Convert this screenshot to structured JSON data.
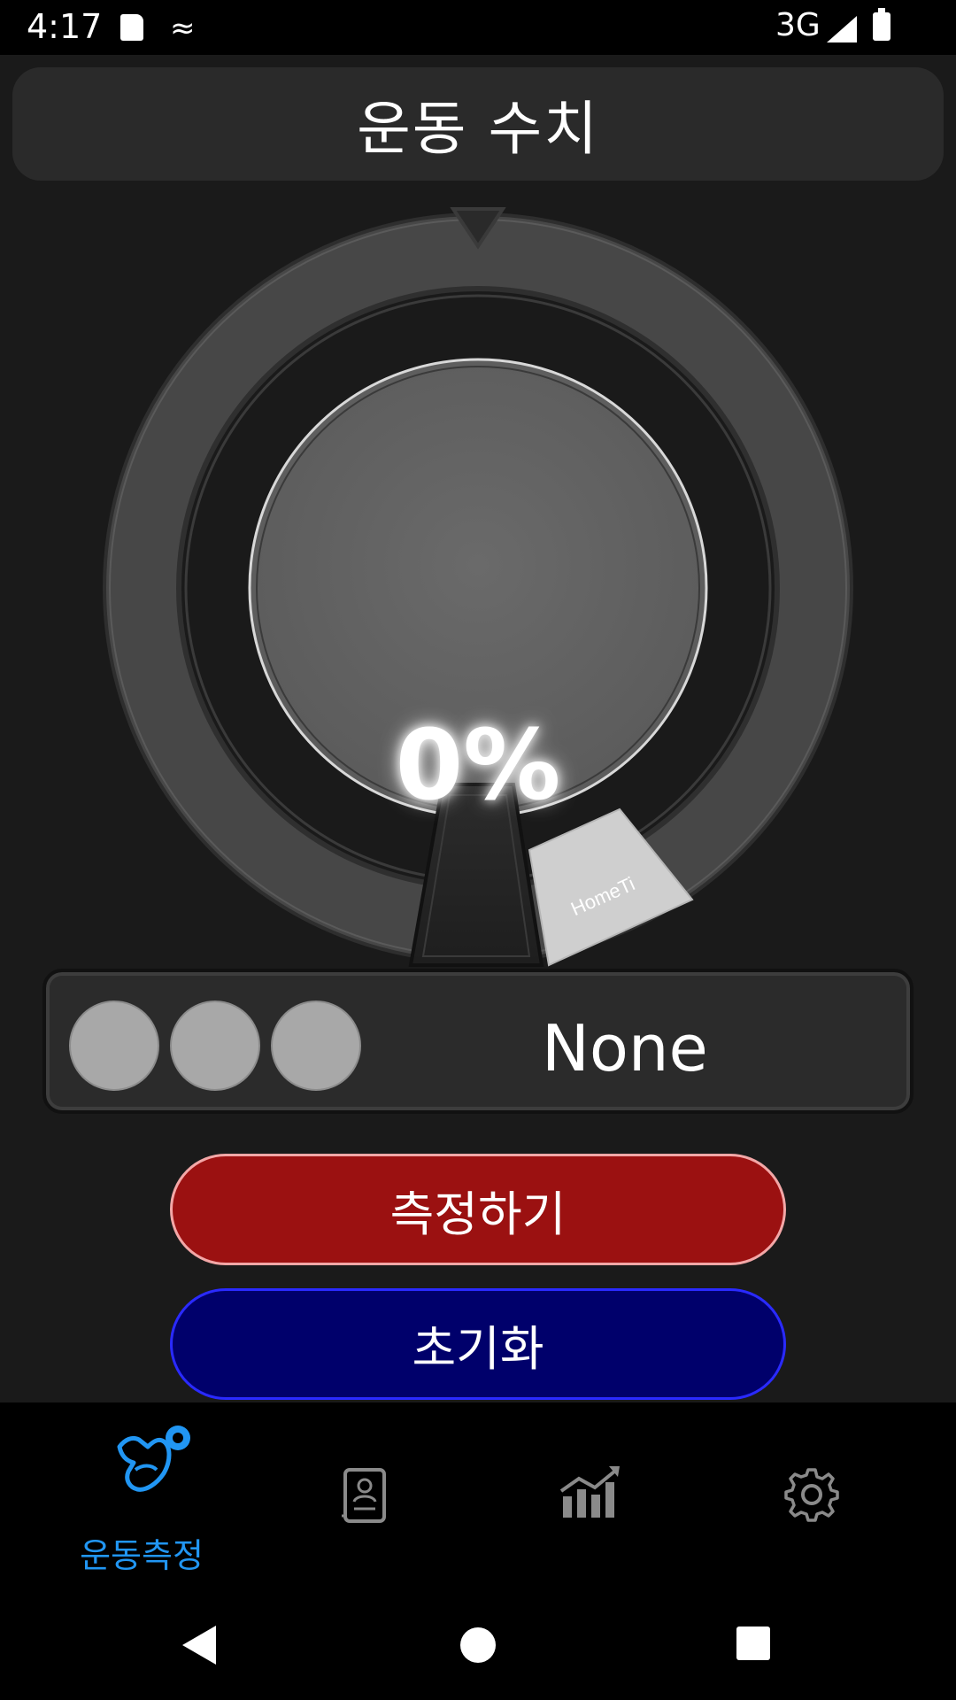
{
  "status_bar": {
    "time": "4:17",
    "network": "3G",
    "debug_glyph": "≈"
  },
  "header": {
    "title": "운동 수치"
  },
  "gauge": {
    "percent_text": "0%",
    "progress": 0,
    "label_tag": "HomeTi"
  },
  "status_panel": {
    "indicator_count": 3,
    "value": "None"
  },
  "buttons": {
    "measure_label": "측정하기",
    "reset_label": "초기화"
  },
  "bottom_nav": {
    "items": [
      {
        "icon": "muscle-arm-icon",
        "label": "운동측정",
        "active": true
      },
      {
        "icon": "profile-document-icon",
        "label": "",
        "active": false
      },
      {
        "icon": "chart-trend-icon",
        "label": "",
        "active": false
      },
      {
        "icon": "gear-icon",
        "label": "",
        "active": false
      }
    ],
    "active_color": "#2196f3",
    "inactive_color": "#8a8a8a"
  },
  "colors": {
    "measure_button": "#9b1111",
    "reset_button": "#00006b",
    "background": "#1a1a1a"
  }
}
